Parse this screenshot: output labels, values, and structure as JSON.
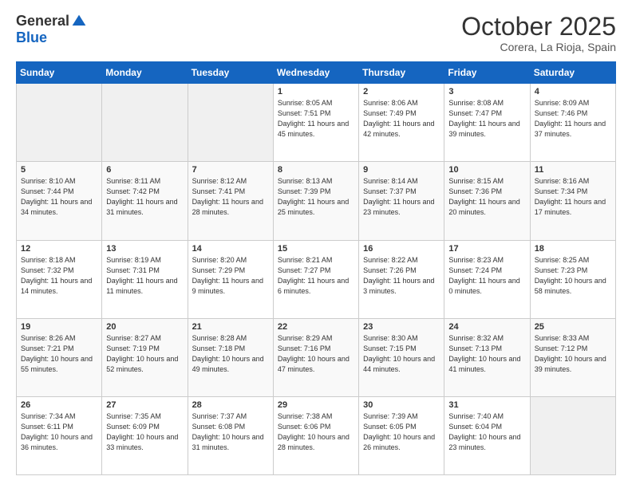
{
  "header": {
    "logo_general": "General",
    "logo_blue": "Blue",
    "month_title": "October 2025",
    "location": "Corera, La Rioja, Spain"
  },
  "days_of_week": [
    "Sunday",
    "Monday",
    "Tuesday",
    "Wednesday",
    "Thursday",
    "Friday",
    "Saturday"
  ],
  "weeks": [
    [
      {
        "num": "",
        "info": ""
      },
      {
        "num": "",
        "info": ""
      },
      {
        "num": "",
        "info": ""
      },
      {
        "num": "1",
        "info": "Sunrise: 8:05 AM\nSunset: 7:51 PM\nDaylight: 11 hours and 45 minutes."
      },
      {
        "num": "2",
        "info": "Sunrise: 8:06 AM\nSunset: 7:49 PM\nDaylight: 11 hours and 42 minutes."
      },
      {
        "num": "3",
        "info": "Sunrise: 8:08 AM\nSunset: 7:47 PM\nDaylight: 11 hours and 39 minutes."
      },
      {
        "num": "4",
        "info": "Sunrise: 8:09 AM\nSunset: 7:46 PM\nDaylight: 11 hours and 37 minutes."
      }
    ],
    [
      {
        "num": "5",
        "info": "Sunrise: 8:10 AM\nSunset: 7:44 PM\nDaylight: 11 hours and 34 minutes."
      },
      {
        "num": "6",
        "info": "Sunrise: 8:11 AM\nSunset: 7:42 PM\nDaylight: 11 hours and 31 minutes."
      },
      {
        "num": "7",
        "info": "Sunrise: 8:12 AM\nSunset: 7:41 PM\nDaylight: 11 hours and 28 minutes."
      },
      {
        "num": "8",
        "info": "Sunrise: 8:13 AM\nSunset: 7:39 PM\nDaylight: 11 hours and 25 minutes."
      },
      {
        "num": "9",
        "info": "Sunrise: 8:14 AM\nSunset: 7:37 PM\nDaylight: 11 hours and 23 minutes."
      },
      {
        "num": "10",
        "info": "Sunrise: 8:15 AM\nSunset: 7:36 PM\nDaylight: 11 hours and 20 minutes."
      },
      {
        "num": "11",
        "info": "Sunrise: 8:16 AM\nSunset: 7:34 PM\nDaylight: 11 hours and 17 minutes."
      }
    ],
    [
      {
        "num": "12",
        "info": "Sunrise: 8:18 AM\nSunset: 7:32 PM\nDaylight: 11 hours and 14 minutes."
      },
      {
        "num": "13",
        "info": "Sunrise: 8:19 AM\nSunset: 7:31 PM\nDaylight: 11 hours and 11 minutes."
      },
      {
        "num": "14",
        "info": "Sunrise: 8:20 AM\nSunset: 7:29 PM\nDaylight: 11 hours and 9 minutes."
      },
      {
        "num": "15",
        "info": "Sunrise: 8:21 AM\nSunset: 7:27 PM\nDaylight: 11 hours and 6 minutes."
      },
      {
        "num": "16",
        "info": "Sunrise: 8:22 AM\nSunset: 7:26 PM\nDaylight: 11 hours and 3 minutes."
      },
      {
        "num": "17",
        "info": "Sunrise: 8:23 AM\nSunset: 7:24 PM\nDaylight: 11 hours and 0 minutes."
      },
      {
        "num": "18",
        "info": "Sunrise: 8:25 AM\nSunset: 7:23 PM\nDaylight: 10 hours and 58 minutes."
      }
    ],
    [
      {
        "num": "19",
        "info": "Sunrise: 8:26 AM\nSunset: 7:21 PM\nDaylight: 10 hours and 55 minutes."
      },
      {
        "num": "20",
        "info": "Sunrise: 8:27 AM\nSunset: 7:19 PM\nDaylight: 10 hours and 52 minutes."
      },
      {
        "num": "21",
        "info": "Sunrise: 8:28 AM\nSunset: 7:18 PM\nDaylight: 10 hours and 49 minutes."
      },
      {
        "num": "22",
        "info": "Sunrise: 8:29 AM\nSunset: 7:16 PM\nDaylight: 10 hours and 47 minutes."
      },
      {
        "num": "23",
        "info": "Sunrise: 8:30 AM\nSunset: 7:15 PM\nDaylight: 10 hours and 44 minutes."
      },
      {
        "num": "24",
        "info": "Sunrise: 8:32 AM\nSunset: 7:13 PM\nDaylight: 10 hours and 41 minutes."
      },
      {
        "num": "25",
        "info": "Sunrise: 8:33 AM\nSunset: 7:12 PM\nDaylight: 10 hours and 39 minutes."
      }
    ],
    [
      {
        "num": "26",
        "info": "Sunrise: 7:34 AM\nSunset: 6:11 PM\nDaylight: 10 hours and 36 minutes."
      },
      {
        "num": "27",
        "info": "Sunrise: 7:35 AM\nSunset: 6:09 PM\nDaylight: 10 hours and 33 minutes."
      },
      {
        "num": "28",
        "info": "Sunrise: 7:37 AM\nSunset: 6:08 PM\nDaylight: 10 hours and 31 minutes."
      },
      {
        "num": "29",
        "info": "Sunrise: 7:38 AM\nSunset: 6:06 PM\nDaylight: 10 hours and 28 minutes."
      },
      {
        "num": "30",
        "info": "Sunrise: 7:39 AM\nSunset: 6:05 PM\nDaylight: 10 hours and 26 minutes."
      },
      {
        "num": "31",
        "info": "Sunrise: 7:40 AM\nSunset: 6:04 PM\nDaylight: 10 hours and 23 minutes."
      },
      {
        "num": "",
        "info": ""
      }
    ]
  ]
}
